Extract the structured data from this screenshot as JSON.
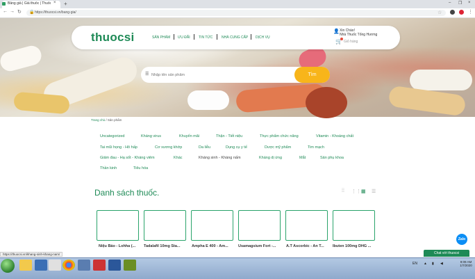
{
  "browser": {
    "tab_title": "Bảng giá | Giá thuốc | Thuốc sỉ",
    "tab_close": "×",
    "new_tab": "+",
    "url": "https://thuocsi.vn/bang-gia/",
    "window_controls": [
      "–",
      "❐",
      "×"
    ]
  },
  "header": {
    "logo": "thuocsi",
    "nav": [
      "SẢN PHẨM",
      "ƯU ĐÃI",
      "TIN TỨC",
      "NHÀ CUNG CẤP",
      "DỊCH VỤ"
    ],
    "user_greeting": "Xin Chào!",
    "user_name": "Nhà Thuốc Tống Hương",
    "cart_label": "Giỏ hàng"
  },
  "search": {
    "placeholder": "Nhập tên sản phẩm",
    "button": "Tìm"
  },
  "breadcrumb": {
    "home": "Trang chủ",
    "separator": " / ",
    "current": "Sản phẩm"
  },
  "categories": [
    [
      "Uncategorized",
      "Kháng virus",
      "Khuyến mãi",
      "Thận - Tiết niệu",
      "Thực phẩm chức năng",
      "Vitamin - Khoáng chất"
    ],
    [
      "Tai mũi họng - Hô hấp",
      "Cơ xương khớp",
      "Da liễu",
      "Dụng cụ y tế",
      "Dược mỹ phẩm",
      "Tim mạch"
    ],
    [
      "Giảm đau - Hạ sốt - Kháng viêm",
      "Khác",
      "Kháng sinh - Kháng nấm",
      "Kháng dị ứng",
      "Mắt",
      "Sản phụ khoa"
    ],
    [
      "Thần kinh",
      "Tiêu hóa"
    ]
  ],
  "list_title": "Danh sách thuốc.",
  "products": [
    "Niệu Bảo - Lohha (...",
    "Tadalafil 10mg Sta...",
    "Ampha E 400 - Am...",
    "Usamagsium Fort -...",
    "A.T Ascorbic - An T...",
    "Ibuten 100mg DHG ..."
  ],
  "status_url": "https://thuocsi.vn/khang-sinh-khang-nam/",
  "widgets": {
    "zalo": "Zalo",
    "chat": "Chat với thuocsi"
  },
  "taskbar": {
    "lang": "EN",
    "time": "9:09 AM",
    "date": "1/7/2020"
  },
  "colors": {
    "brand_green": "#1e8a56",
    "search_button": "#f8b51a"
  }
}
